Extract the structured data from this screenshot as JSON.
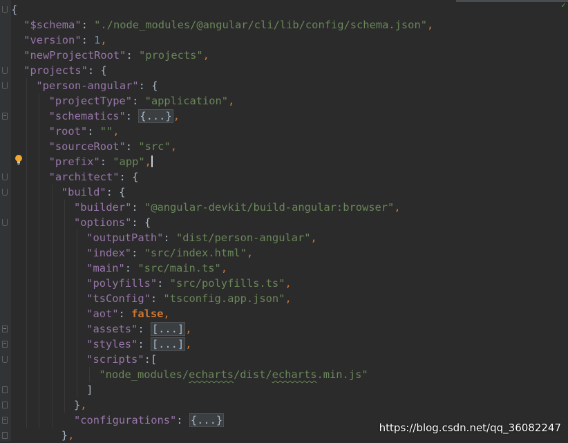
{
  "editor": {
    "lines": [
      {
        "tokens": [
          {
            "t": "p",
            "v": "{"
          }
        ]
      },
      {
        "tokens": [
          {
            "t": "k",
            "v": "\"$schema\""
          },
          {
            "t": "p",
            "v": ": "
          },
          {
            "t": "s",
            "v": "\"./node_modules/@angular/cli/lib/config/schema.json\""
          },
          {
            "t": "c",
            "v": ","
          }
        ]
      },
      {
        "tokens": [
          {
            "t": "k",
            "v": "\"version\""
          },
          {
            "t": "p",
            "v": ": "
          },
          {
            "t": "n",
            "v": "1"
          },
          {
            "t": "c",
            "v": ","
          }
        ]
      },
      {
        "tokens": [
          {
            "t": "k",
            "v": "\"newProjectRoot\""
          },
          {
            "t": "p",
            "v": ": "
          },
          {
            "t": "s",
            "v": "\"projects\""
          },
          {
            "t": "c",
            "v": ","
          }
        ]
      },
      {
        "tokens": [
          {
            "t": "k",
            "v": "\"projects\""
          },
          {
            "t": "p",
            "v": ": {"
          }
        ]
      },
      {
        "tokens": [
          {
            "t": "k",
            "v": "\"person-angular\""
          },
          {
            "t": "p",
            "v": ": {"
          }
        ]
      },
      {
        "tokens": [
          {
            "t": "k",
            "v": "\"projectType\""
          },
          {
            "t": "p",
            "v": ": "
          },
          {
            "t": "s",
            "v": "\"application\""
          },
          {
            "t": "c",
            "v": ","
          }
        ]
      },
      {
        "tokens": [
          {
            "t": "k",
            "v": "\"schematics\""
          },
          {
            "t": "p",
            "v": ": "
          },
          {
            "t": "collapsed",
            "v": "{...}"
          },
          {
            "t": "c",
            "v": ","
          }
        ]
      },
      {
        "tokens": [
          {
            "t": "k",
            "v": "\"root\""
          },
          {
            "t": "p",
            "v": ": "
          },
          {
            "t": "s",
            "v": "\"\""
          },
          {
            "t": "c",
            "v": ","
          }
        ]
      },
      {
        "tokens": [
          {
            "t": "k",
            "v": "\"sourceRoot\""
          },
          {
            "t": "p",
            "v": ": "
          },
          {
            "t": "s",
            "v": "\"src\""
          },
          {
            "t": "c",
            "v": ","
          }
        ]
      },
      {
        "tokens": [
          {
            "t": "k",
            "v": "\"prefix\""
          },
          {
            "t": "p",
            "v": ": "
          },
          {
            "t": "s",
            "v": "\"app\""
          },
          {
            "t": "c",
            "v": ","
          },
          {
            "t": "caret",
            "v": ""
          }
        ]
      },
      {
        "tokens": [
          {
            "t": "k",
            "v": "\"architect\""
          },
          {
            "t": "p",
            "v": ": {"
          }
        ]
      },
      {
        "tokens": [
          {
            "t": "k",
            "v": "\"build\""
          },
          {
            "t": "p",
            "v": ": {"
          }
        ]
      },
      {
        "tokens": [
          {
            "t": "k",
            "v": "\"builder\""
          },
          {
            "t": "p",
            "v": ": "
          },
          {
            "t": "s",
            "v": "\"@angular-devkit/build-angular:browser\""
          },
          {
            "t": "c",
            "v": ","
          }
        ]
      },
      {
        "tokens": [
          {
            "t": "k",
            "v": "\"options\""
          },
          {
            "t": "p",
            "v": ": {"
          }
        ]
      },
      {
        "tokens": [
          {
            "t": "k",
            "v": "\"outputPath\""
          },
          {
            "t": "p",
            "v": ": "
          },
          {
            "t": "s",
            "v": "\"dist/person-angular\""
          },
          {
            "t": "c",
            "v": ","
          }
        ]
      },
      {
        "tokens": [
          {
            "t": "k",
            "v": "\"index\""
          },
          {
            "t": "p",
            "v": ": "
          },
          {
            "t": "s",
            "v": "\"src/index.html\""
          },
          {
            "t": "c",
            "v": ","
          }
        ]
      },
      {
        "tokens": [
          {
            "t": "k",
            "v": "\"main\""
          },
          {
            "t": "p",
            "v": ": "
          },
          {
            "t": "s",
            "v": "\"src/main.ts\""
          },
          {
            "t": "c",
            "v": ","
          }
        ]
      },
      {
        "tokens": [
          {
            "t": "k",
            "v": "\"polyfills\""
          },
          {
            "t": "p",
            "v": ": "
          },
          {
            "t": "s",
            "v": "\"src/polyfills.ts\""
          },
          {
            "t": "c",
            "v": ","
          }
        ]
      },
      {
        "tokens": [
          {
            "t": "k",
            "v": "\"tsConfig\""
          },
          {
            "t": "p",
            "v": ": "
          },
          {
            "t": "s",
            "v": "\"tsconfig.app.json\""
          },
          {
            "t": "c",
            "v": ","
          }
        ]
      },
      {
        "tokens": [
          {
            "t": "k",
            "v": "\"aot\""
          },
          {
            "t": "p",
            "v": ": "
          },
          {
            "t": "b",
            "v": "false"
          },
          {
            "t": "c",
            "v": ","
          }
        ]
      },
      {
        "tokens": [
          {
            "t": "k",
            "v": "\"assets\""
          },
          {
            "t": "p",
            "v": ": "
          },
          {
            "t": "collapsed",
            "v": "[...]"
          },
          {
            "t": "c",
            "v": ","
          }
        ]
      },
      {
        "tokens": [
          {
            "t": "k",
            "v": "\"styles\""
          },
          {
            "t": "p",
            "v": ": "
          },
          {
            "t": "collapsed",
            "v": "[...]"
          },
          {
            "t": "c",
            "v": ","
          }
        ]
      },
      {
        "tokens": [
          {
            "t": "k",
            "v": "\"scripts\""
          },
          {
            "t": "p",
            "v": ":["
          }
        ]
      },
      {
        "tokens": [
          {
            "t": "s",
            "v": "\"node_modules/"
          },
          {
            "t": "sq",
            "v": "echarts"
          },
          {
            "t": "s",
            "v": "/dist/"
          },
          {
            "t": "sq",
            "v": "echarts"
          },
          {
            "t": "s",
            "v": ".min.js\""
          }
        ]
      },
      {
        "tokens": [
          {
            "t": "p",
            "v": "]"
          }
        ]
      },
      {
        "tokens": [
          {
            "t": "p",
            "v": "}"
          },
          {
            "t": "c",
            "v": ","
          }
        ]
      },
      {
        "tokens": [
          {
            "t": "k",
            "v": "\"configurations\""
          },
          {
            "t": "p",
            "v": ": "
          },
          {
            "t": "collapsed",
            "v": "{...}"
          }
        ]
      },
      {
        "tokens": [
          {
            "t": "p",
            "v": "}"
          },
          {
            "t": "c",
            "v": ","
          }
        ]
      }
    ]
  },
  "watermark": "https://blog.csdn.net/qq_36082247"
}
